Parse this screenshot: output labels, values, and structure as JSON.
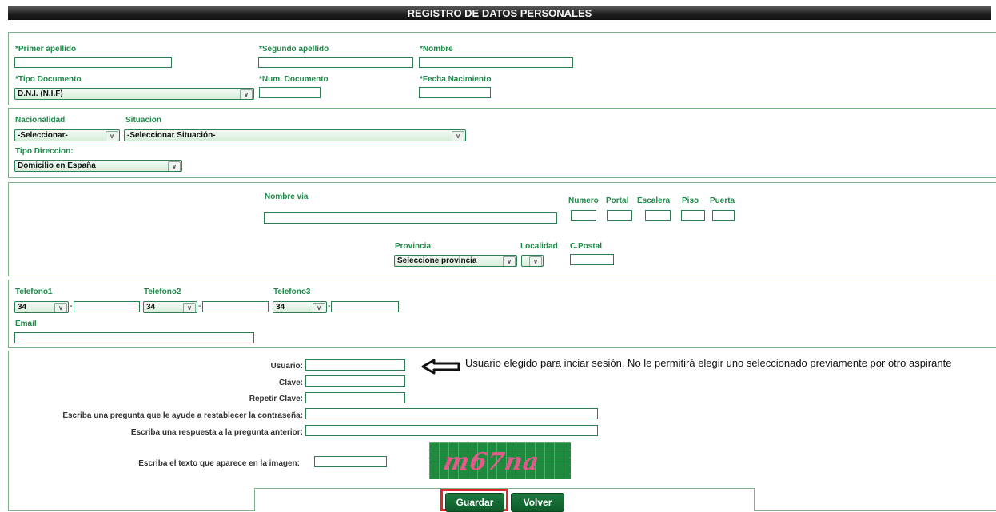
{
  "title": "REGISTRO DE DATOS PERSONALES",
  "personal": {
    "primer_apellido": "*Primer apellido",
    "segundo_apellido": "*Segundo apellido",
    "nombre": "*Nombre",
    "tipo_documento": "*Tipo Documento",
    "tipo_documento_value": "D.N.I. (N.I.F)",
    "num_documento": "*Num. Documento",
    "fecha_nacimiento": "*Fecha Nacimiento"
  },
  "nacionalidad": {
    "label": "Nacionalidad",
    "value": "-Seleccionar-",
    "situacion_label": "Situacion",
    "situacion_value": "-Seleccionar Situación-",
    "tipo_direccion_label": "Tipo Direccion:",
    "tipo_direccion_value": "Domicilio en España"
  },
  "direccion": {
    "nombre_via": "Nombre via",
    "numero": "Numero",
    "portal": "Portal",
    "escalera": "Escalera",
    "piso": "Piso",
    "puerta": "Puerta",
    "provincia": "Provincia",
    "provincia_value": "Seleccione provincia",
    "localidad": "Localidad",
    "cpostal": "C.Postal"
  },
  "contacto": {
    "telefono1": "Telefono1",
    "telefono2": "Telefono2",
    "telefono3": "Telefono3",
    "prefix": "34",
    "dash": "-",
    "email": "Email"
  },
  "cuenta": {
    "usuario": "Usuario:",
    "clave": "Clave:",
    "repetir_clave": "Repetir Clave:",
    "pregunta": "Escriba una pregunta que le ayude a restablecer la contraseña:",
    "respuesta": "Escriba una respuesta a la pregunta anterior:",
    "captcha_label": "Escriba el texto que aparece en la imagen:",
    "captcha_text": "m67na",
    "note": "Usuario elegido para inciar sesión. No le permitirá elegir uno seleccionado previamente por otro aspirante"
  },
  "buttons": {
    "guardar": "Guardar",
    "volver": "Volver"
  },
  "colors": {
    "label_green": "#1d8a4a",
    "button_green": "#0d5b2a",
    "highlight_red": "#e0262b"
  }
}
